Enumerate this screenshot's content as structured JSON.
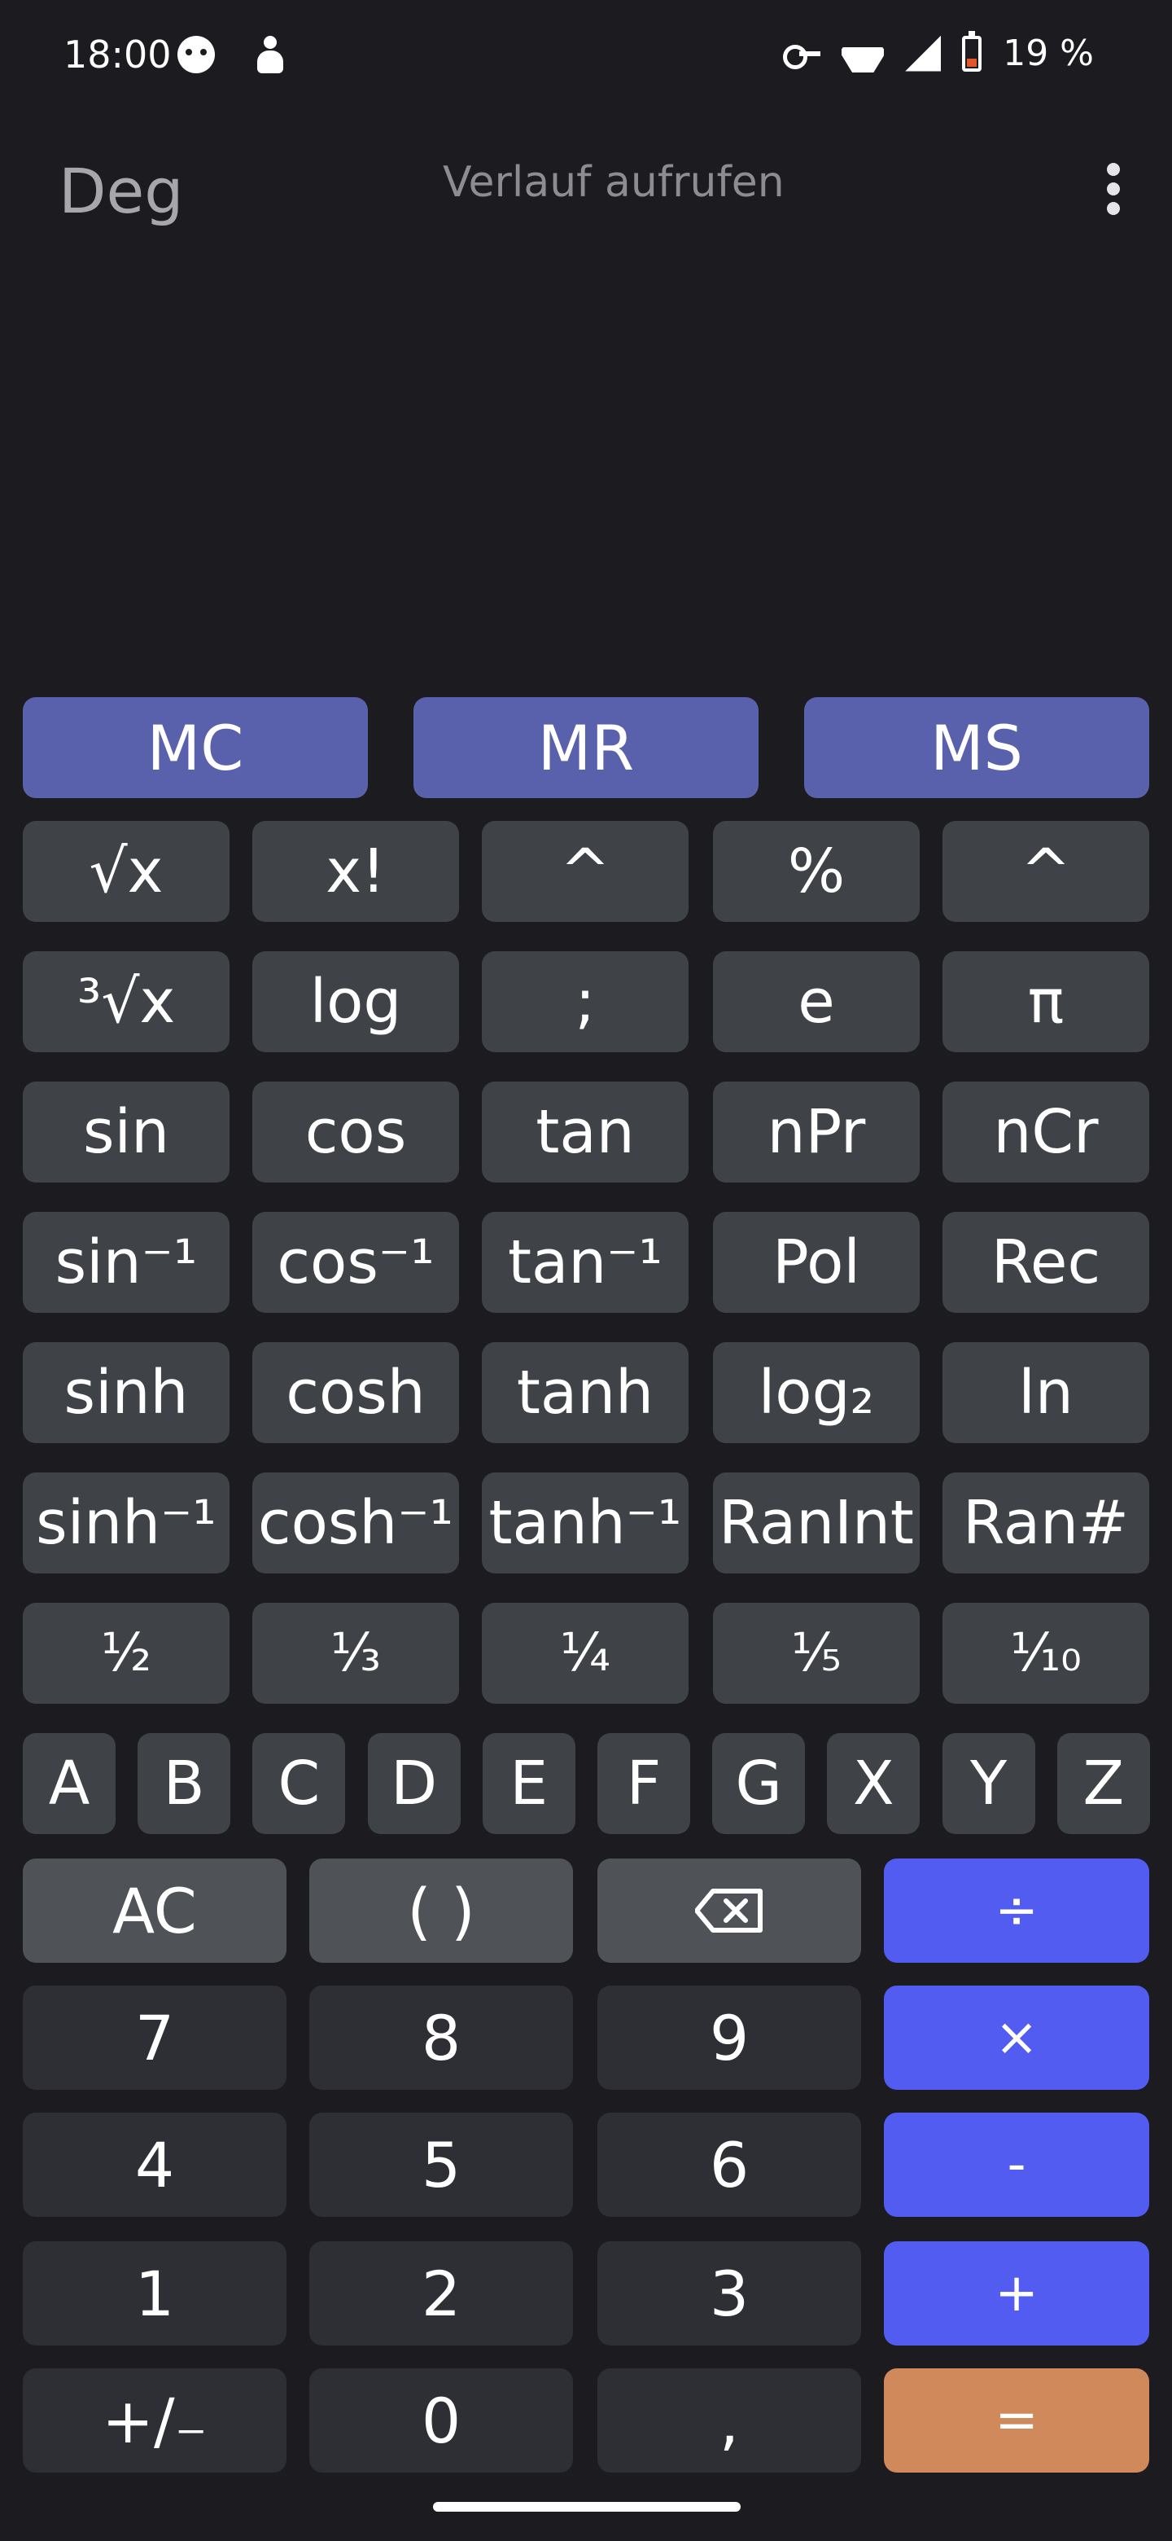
{
  "status_bar": {
    "time": "18:00",
    "battery_percent": "19 %",
    "battery_color": "#e3552b",
    "icons": [
      "cat-face-icon",
      "figure-icon",
      "vpn-key-icon",
      "wifi-icon",
      "cell-signal-icon",
      "battery-icon"
    ]
  },
  "header": {
    "angle_mode": "Deg",
    "history_label": "Verlauf aufrufen",
    "menu_icon": "more-vert-icon"
  },
  "memory": [
    "MC",
    "MR",
    "MS"
  ],
  "scientific_rows": [
    [
      "√x",
      "x!",
      "^",
      "%",
      "^"
    ],
    [
      "³√x",
      "log",
      ";",
      "e",
      "π"
    ],
    [
      "sin",
      "cos",
      "tan",
      "nPr",
      "nCr"
    ],
    [
      "sin⁻¹",
      "cos⁻¹",
      "tan⁻¹",
      "Pol",
      "Rec"
    ],
    [
      "sinh",
      "cosh",
      "tanh",
      "log₂",
      "ln"
    ],
    [
      "sinh⁻¹",
      "cosh⁻¹",
      "tanh⁻¹",
      "RanInt",
      "Ran#"
    ]
  ],
  "fractions": [
    "½",
    "⅓",
    "¼",
    "⅕",
    "⅒"
  ],
  "letters": [
    "A",
    "B",
    "C",
    "D",
    "E",
    "F",
    "G",
    "X",
    "Y",
    "Z"
  ],
  "keypad": {
    "clear": "AC",
    "parens": "( )",
    "backspace_icon": "backspace-icon",
    "divide": "÷",
    "multiply": "×",
    "minus": "-",
    "plus": "+",
    "equals": "=",
    "sign": "+/₋",
    "decimal": ",",
    "digits": [
      "7",
      "8",
      "9",
      "4",
      "5",
      "6",
      "1",
      "2",
      "3",
      "0"
    ]
  },
  "colors": {
    "background": "#1b1b20",
    "memory_key": "#5961ad",
    "function_key": "#3f4246",
    "operator_key": "#525cf0",
    "equals_key": "#d0895a",
    "number_key": "#2e2f35"
  }
}
